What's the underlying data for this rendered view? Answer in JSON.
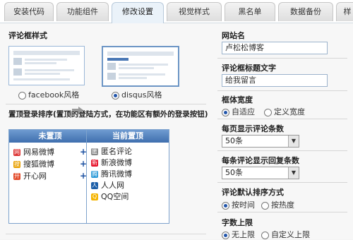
{
  "tabs": [
    {
      "label": "安装代码"
    },
    {
      "label": "功能组件"
    },
    {
      "label": "修改设置",
      "active": true
    },
    {
      "label": "视觉样式"
    },
    {
      "label": "黑名单"
    },
    {
      "label": "数据备份"
    },
    {
      "label": "样"
    }
  ],
  "comment_style": {
    "title": "评论框样式",
    "options": [
      {
        "label": "facebook风格",
        "selected": false
      },
      {
        "label": "disqus风格",
        "selected": true
      }
    ]
  },
  "login_order": {
    "title": "置顶登录排序(置顶的登陆方式，在功能区有额外的登录按钮)",
    "unpinned": {
      "header": "未置顶",
      "items": [
        {
          "label": "网易微博",
          "icon": "netease-icon",
          "color": "#d33"
        },
        {
          "label": "搜狐微博",
          "icon": "sohu-icon",
          "color": "#e8a000"
        },
        {
          "label": "开心网",
          "icon": "kaixin-icon",
          "color": "#e34b2a"
        }
      ],
      "plus": "+"
    },
    "pinned": {
      "header": "当前置顶",
      "items": [
        {
          "label": "匿名评论",
          "icon": "anonymous-icon",
          "color": "#888"
        },
        {
          "label": "新浪微博",
          "icon": "sina-icon",
          "color": "#e6162d"
        },
        {
          "label": "腾讯微博",
          "icon": "tencent-icon",
          "color": "#2c9ad8"
        },
        {
          "label": "人人网",
          "icon": "renren-icon",
          "color": "#1d5fa8"
        },
        {
          "label": "QQ空间",
          "icon": "qzone-icon",
          "color": "#f5b400"
        }
      ]
    }
  },
  "settings": {
    "site_name": {
      "label": "网站名",
      "value": "卢松松博客"
    },
    "box_title": {
      "label": "评论框标题文字",
      "value": "给我留言"
    },
    "box_width": {
      "label": "框体宽度",
      "options": [
        {
          "label": "自适应",
          "selected": true
        },
        {
          "label": "定义宽度",
          "selected": false
        }
      ]
    },
    "per_page": {
      "label": "每页显示评论条数",
      "value": "50条"
    },
    "replies": {
      "label": "每条评论显示回复条数",
      "value": "50条"
    },
    "sort": {
      "label": "评论默认排序方式",
      "options": [
        {
          "label": "按时间",
          "selected": true
        },
        {
          "label": "按热度",
          "selected": false
        }
      ]
    },
    "word_limit": {
      "label": "字数上限",
      "options": [
        {
          "label": "无上限",
          "selected": true
        },
        {
          "label": "自定义上限",
          "selected": false
        }
      ]
    }
  }
}
